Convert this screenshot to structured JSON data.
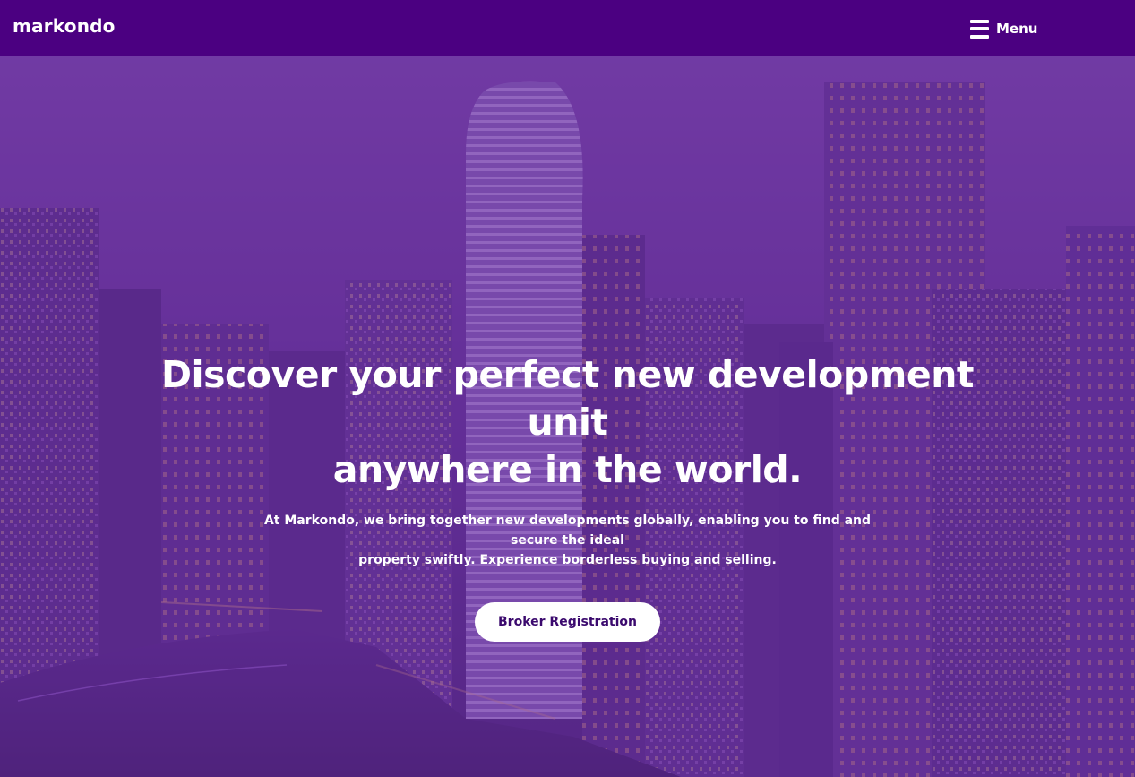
{
  "brand": {
    "logo_text": "markondo"
  },
  "header": {
    "menu_label": "Menu"
  },
  "hero": {
    "headline_line1": "Discover your perfect new development unit",
    "headline_line2": "anywhere in the world.",
    "subtext_line1": "At Markondo, we bring together new developments globally, enabling you to find and secure the ideal",
    "subtext_line2": "property swiftly. Experience borderless buying and selling.",
    "cta_label": "Broker Registration"
  },
  "colors": {
    "header_bg": "#4b0081",
    "overlay": "#6a2da0",
    "cta_text": "#3b0a6e"
  },
  "icons": {
    "menu": "hamburger-icon"
  }
}
